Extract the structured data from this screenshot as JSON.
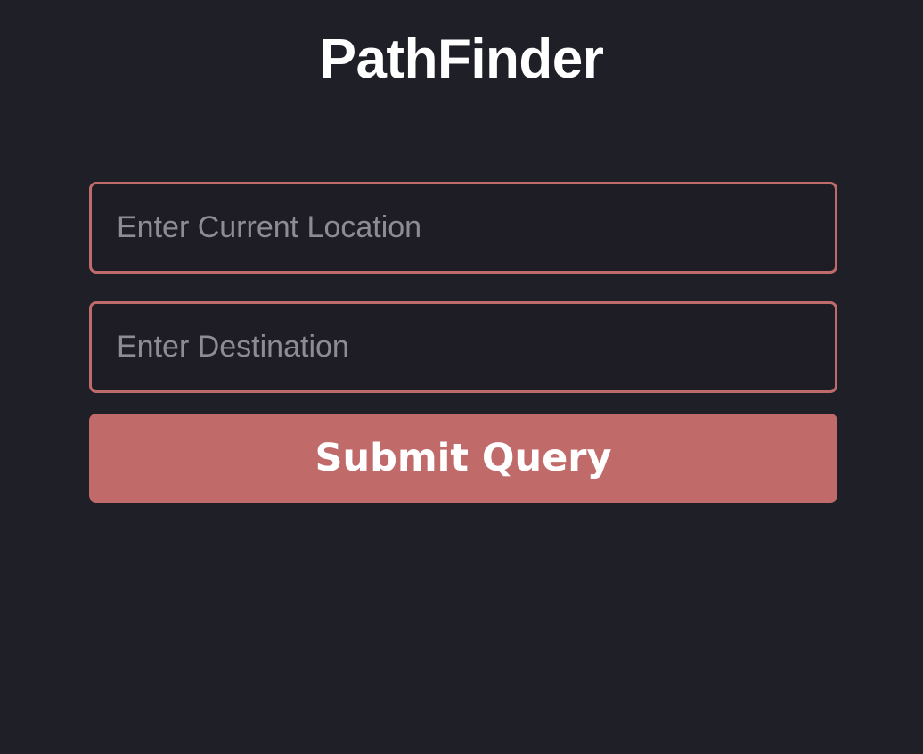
{
  "app": {
    "title": "PathFinder"
  },
  "form": {
    "current_location": {
      "value": "",
      "placeholder": "Enter Current Location"
    },
    "destination": {
      "value": "",
      "placeholder": "Enter Destination"
    },
    "submit_label": "Submit Query"
  },
  "colors": {
    "background": "#1f1f27",
    "accent": "#c06b6a",
    "placeholder_text": "#8d8c92",
    "title_text": "#ffffff"
  }
}
